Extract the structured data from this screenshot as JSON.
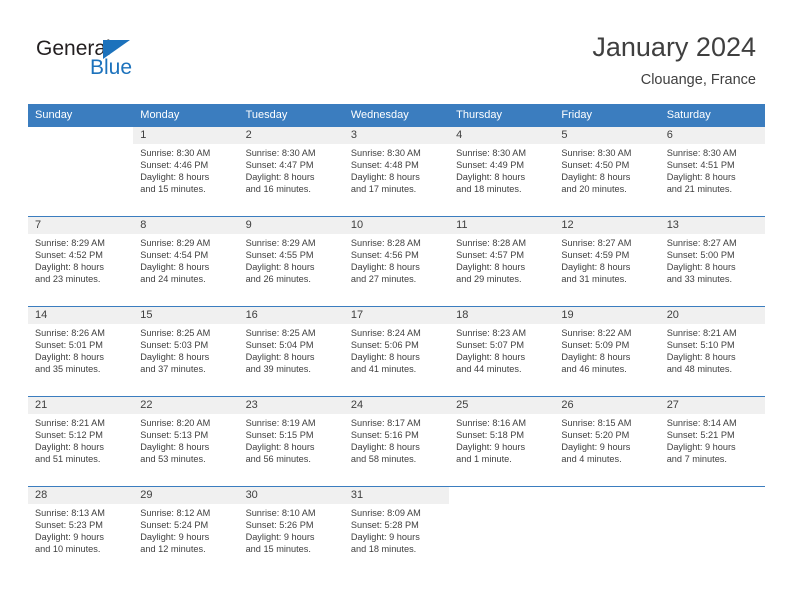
{
  "brand": {
    "name_part1": "General",
    "name_part2": "Blue",
    "triangle_icon": "triangle-icon",
    "accent_color": "#1c72bc"
  },
  "header": {
    "title": "January 2024",
    "location": "Clouange, France"
  },
  "theme": {
    "header_band": "#3b7dbf",
    "day_band": "#f0f0f0",
    "text": "#3f3f3f"
  },
  "weekday_headers": [
    "Sunday",
    "Monday",
    "Tuesday",
    "Wednesday",
    "Thursday",
    "Friday",
    "Saturday"
  ],
  "weeks": [
    [
      {
        "day": "",
        "lines": [
          "",
          "",
          "",
          ""
        ],
        "blank": true
      },
      {
        "day": "1",
        "lines": [
          "Sunrise: 8:30 AM",
          "Sunset: 4:46 PM",
          "Daylight: 8 hours",
          "and 15 minutes."
        ]
      },
      {
        "day": "2",
        "lines": [
          "Sunrise: 8:30 AM",
          "Sunset: 4:47 PM",
          "Daylight: 8 hours",
          "and 16 minutes."
        ]
      },
      {
        "day": "3",
        "lines": [
          "Sunrise: 8:30 AM",
          "Sunset: 4:48 PM",
          "Daylight: 8 hours",
          "and 17 minutes."
        ]
      },
      {
        "day": "4",
        "lines": [
          "Sunrise: 8:30 AM",
          "Sunset: 4:49 PM",
          "Daylight: 8 hours",
          "and 18 minutes."
        ]
      },
      {
        "day": "5",
        "lines": [
          "Sunrise: 8:30 AM",
          "Sunset: 4:50 PM",
          "Daylight: 8 hours",
          "and 20 minutes."
        ]
      },
      {
        "day": "6",
        "lines": [
          "Sunrise: 8:30 AM",
          "Sunset: 4:51 PM",
          "Daylight: 8 hours",
          "and 21 minutes."
        ]
      }
    ],
    [
      {
        "day": "7",
        "lines": [
          "Sunrise: 8:29 AM",
          "Sunset: 4:52 PM",
          "Daylight: 8 hours",
          "and 23 minutes."
        ]
      },
      {
        "day": "8",
        "lines": [
          "Sunrise: 8:29 AM",
          "Sunset: 4:54 PM",
          "Daylight: 8 hours",
          "and 24 minutes."
        ]
      },
      {
        "day": "9",
        "lines": [
          "Sunrise: 8:29 AM",
          "Sunset: 4:55 PM",
          "Daylight: 8 hours",
          "and 26 minutes."
        ]
      },
      {
        "day": "10",
        "lines": [
          "Sunrise: 8:28 AM",
          "Sunset: 4:56 PM",
          "Daylight: 8 hours",
          "and 27 minutes."
        ]
      },
      {
        "day": "11",
        "lines": [
          "Sunrise: 8:28 AM",
          "Sunset: 4:57 PM",
          "Daylight: 8 hours",
          "and 29 minutes."
        ]
      },
      {
        "day": "12",
        "lines": [
          "Sunrise: 8:27 AM",
          "Sunset: 4:59 PM",
          "Daylight: 8 hours",
          "and 31 minutes."
        ]
      },
      {
        "day": "13",
        "lines": [
          "Sunrise: 8:27 AM",
          "Sunset: 5:00 PM",
          "Daylight: 8 hours",
          "and 33 minutes."
        ]
      }
    ],
    [
      {
        "day": "14",
        "lines": [
          "Sunrise: 8:26 AM",
          "Sunset: 5:01 PM",
          "Daylight: 8 hours",
          "and 35 minutes."
        ]
      },
      {
        "day": "15",
        "lines": [
          "Sunrise: 8:25 AM",
          "Sunset: 5:03 PM",
          "Daylight: 8 hours",
          "and 37 minutes."
        ]
      },
      {
        "day": "16",
        "lines": [
          "Sunrise: 8:25 AM",
          "Sunset: 5:04 PM",
          "Daylight: 8 hours",
          "and 39 minutes."
        ]
      },
      {
        "day": "17",
        "lines": [
          "Sunrise: 8:24 AM",
          "Sunset: 5:06 PM",
          "Daylight: 8 hours",
          "and 41 minutes."
        ]
      },
      {
        "day": "18",
        "lines": [
          "Sunrise: 8:23 AM",
          "Sunset: 5:07 PM",
          "Daylight: 8 hours",
          "and 44 minutes."
        ]
      },
      {
        "day": "19",
        "lines": [
          "Sunrise: 8:22 AM",
          "Sunset: 5:09 PM",
          "Daylight: 8 hours",
          "and 46 minutes."
        ]
      },
      {
        "day": "20",
        "lines": [
          "Sunrise: 8:21 AM",
          "Sunset: 5:10 PM",
          "Daylight: 8 hours",
          "and 48 minutes."
        ]
      }
    ],
    [
      {
        "day": "21",
        "lines": [
          "Sunrise: 8:21 AM",
          "Sunset: 5:12 PM",
          "Daylight: 8 hours",
          "and 51 minutes."
        ]
      },
      {
        "day": "22",
        "lines": [
          "Sunrise: 8:20 AM",
          "Sunset: 5:13 PM",
          "Daylight: 8 hours",
          "and 53 minutes."
        ]
      },
      {
        "day": "23",
        "lines": [
          "Sunrise: 8:19 AM",
          "Sunset: 5:15 PM",
          "Daylight: 8 hours",
          "and 56 minutes."
        ]
      },
      {
        "day": "24",
        "lines": [
          "Sunrise: 8:17 AM",
          "Sunset: 5:16 PM",
          "Daylight: 8 hours",
          "and 58 minutes."
        ]
      },
      {
        "day": "25",
        "lines": [
          "Sunrise: 8:16 AM",
          "Sunset: 5:18 PM",
          "Daylight: 9 hours",
          "and 1 minute."
        ]
      },
      {
        "day": "26",
        "lines": [
          "Sunrise: 8:15 AM",
          "Sunset: 5:20 PM",
          "Daylight: 9 hours",
          "and 4 minutes."
        ]
      },
      {
        "day": "27",
        "lines": [
          "Sunrise: 8:14 AM",
          "Sunset: 5:21 PM",
          "Daylight: 9 hours",
          "and 7 minutes."
        ]
      }
    ],
    [
      {
        "day": "28",
        "lines": [
          "Sunrise: 8:13 AM",
          "Sunset: 5:23 PM",
          "Daylight: 9 hours",
          "and 10 minutes."
        ]
      },
      {
        "day": "29",
        "lines": [
          "Sunrise: 8:12 AM",
          "Sunset: 5:24 PM",
          "Daylight: 9 hours",
          "and 12 minutes."
        ]
      },
      {
        "day": "30",
        "lines": [
          "Sunrise: 8:10 AM",
          "Sunset: 5:26 PM",
          "Daylight: 9 hours",
          "and 15 minutes."
        ]
      },
      {
        "day": "31",
        "lines": [
          "Sunrise: 8:09 AM",
          "Sunset: 5:28 PM",
          "Daylight: 9 hours",
          "and 18 minutes."
        ]
      },
      {
        "day": "",
        "lines": [
          "",
          "",
          "",
          ""
        ],
        "blank": true
      },
      {
        "day": "",
        "lines": [
          "",
          "",
          "",
          ""
        ],
        "blank": true
      },
      {
        "day": "",
        "lines": [
          "",
          "",
          "",
          ""
        ],
        "blank": true
      }
    ]
  ]
}
